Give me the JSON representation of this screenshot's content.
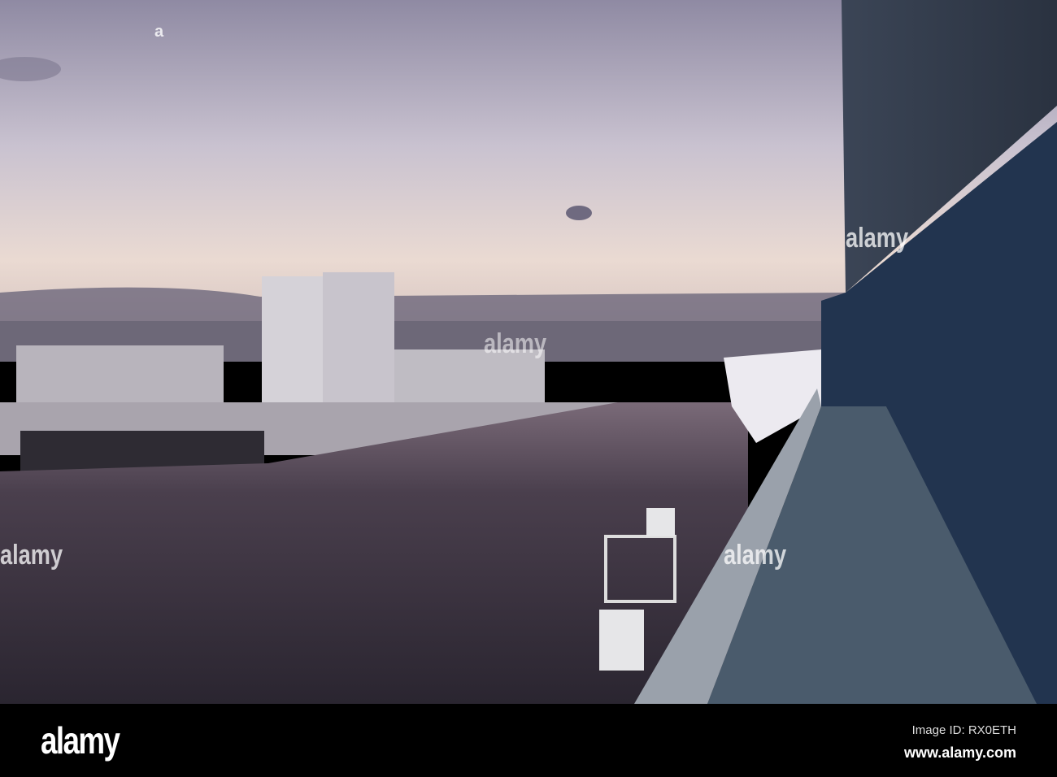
{
  "photo": {
    "subject": "harbor-view-from-ship-deck"
  },
  "watermark": {
    "logo": "alamy",
    "center_text": "alamy"
  },
  "footer": {
    "logo": "alamy",
    "image_id": "Image ID: RX0ETH",
    "url": "www.alamy.com"
  }
}
